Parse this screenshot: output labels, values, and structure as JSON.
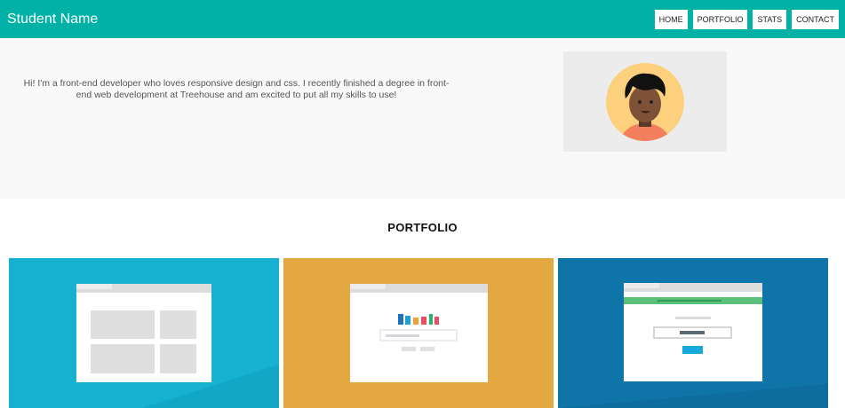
{
  "header": {
    "brand": "Student Name",
    "nav": [
      "HOME",
      "PORTFOLIO",
      "STATS",
      "CONTACT"
    ]
  },
  "hero": {
    "intro": "Hi! I'm a front-end developer who loves responsive design and css. I recently finished a degree in front-end web development at Treehouse and am excited to put all my skills to use!",
    "avatar_icon": "avatar-illustration"
  },
  "portfolio": {
    "title": "PORTFOLIO",
    "cards": [
      {
        "icon": "grid-layout-mockup",
        "color": "#16b1d1"
      },
      {
        "icon": "bar-chart-mockup",
        "color": "#e3a840"
      },
      {
        "icon": "form-mockup",
        "color": "#0f75a8"
      }
    ]
  },
  "colors": {
    "header": "#00b2a6",
    "hero_bg": "#f9f9f9",
    "avatar_bg": "#ececec"
  }
}
